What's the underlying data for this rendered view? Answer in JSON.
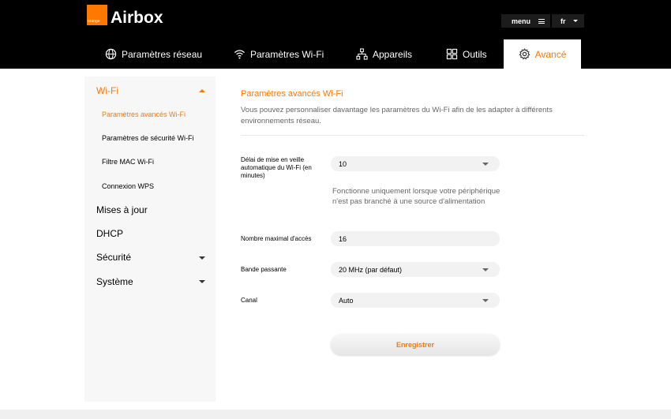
{
  "header": {
    "logo_text": "orange",
    "brand": "Airbox",
    "menu_label": "menu",
    "lang_label": "fr"
  },
  "tabs": [
    {
      "label": "Paramètres réseau",
      "icon": "globe-icon"
    },
    {
      "label": "Paramètres Wi-Fi",
      "icon": "wifi-icon"
    },
    {
      "label": "Appareils",
      "icon": "devices-icon"
    },
    {
      "label": "Outils",
      "icon": "tools-icon"
    },
    {
      "label": "Avancé",
      "icon": "gear-icon",
      "active": true
    }
  ],
  "sidebar": {
    "wifi": {
      "label": "Wi-Fi",
      "subitems": [
        {
          "label": "Paramètres avancés Wi-Fi",
          "active": true
        },
        {
          "label": "Paramètres de sécurité Wi-Fi"
        },
        {
          "label": "Filtre MAC Wi-Fi"
        },
        {
          "label": "Connexion WPS"
        }
      ]
    },
    "updates": "Mises à jour",
    "dhcp": "DHCP",
    "security": "Sécurité",
    "system": "Système"
  },
  "content": {
    "title": "Paramètres avancés Wi-Fi",
    "description": "Vous pouvez personnaliser davantage les paramètres du Wi-Fi afin de les adapter à différents environnements réseau.",
    "sleep": {
      "label": "Délai de mise en veille automatique du Wi-Fi (en minutes)",
      "value": "10",
      "hint": "Fonctionne uniquement lorsque votre périphérique n'est pas branché à une source d'alimentation"
    },
    "max_access": {
      "label": "Nombre maximal d'accès",
      "value": "16"
    },
    "bandwidth": {
      "label": "Bande passante",
      "value": "20 MHz (par défaut)"
    },
    "channel": {
      "label": "Canal",
      "value": "Auto"
    },
    "save_label": "Enregistrer"
  },
  "colors": {
    "accent": "#ff7900",
    "header_bg": "#000000",
    "sidebar_bg": "#f7f7f7",
    "field_bg": "#f2f2f2"
  }
}
